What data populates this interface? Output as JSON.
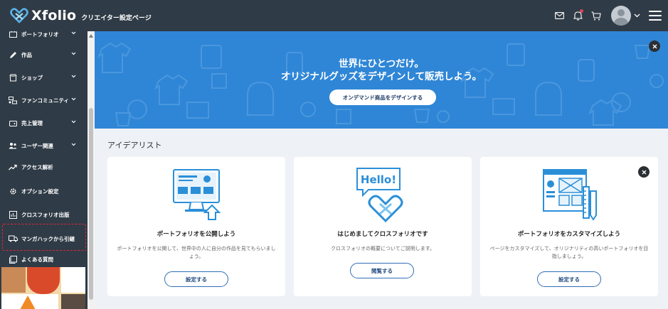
{
  "header": {
    "logo_text": "Xfolio",
    "subtitle": "クリエイター設定ページ"
  },
  "sidebar": {
    "items": [
      {
        "label": "ポートフォリオ"
      },
      {
        "label": "作品"
      },
      {
        "label": "ショップ"
      },
      {
        "label": "ファンコミュニティ"
      },
      {
        "label": "売上管理"
      },
      {
        "label": "ユーザー関連"
      },
      {
        "label": "アクセス解析"
      },
      {
        "label": "オプション設定"
      },
      {
        "label": "クロスフォリオ出版"
      },
      {
        "label": "マンガハックから引継"
      },
      {
        "label": "よくある質問"
      }
    ]
  },
  "hero": {
    "line1": "世界にひとつだけ。",
    "line2": "オリジナルグッズをデザインして販売しよう。",
    "button": "オンデマンド商品をデザインする"
  },
  "ideas": {
    "title": "アイデアリスト",
    "cards": [
      {
        "title": "ポートフォリオを公開しよう",
        "desc": "ポートフォリオを公開して、世界中の人に自分の作品を見てもらいましょう。",
        "button": "設定する",
        "illustration": "monitor-upload-illustration"
      },
      {
        "title": "はじめましてクロスフォリオです",
        "desc": "クロスフォリオの概要についてご説明します。",
        "button": "閲覧する",
        "speech_text": "Hello!",
        "illustration": "hello-heart-illustration"
      },
      {
        "title": "ポートフォリオをカスタマイズしよう",
        "desc": "ページをカスタマイズして、オリジナリティの高いポートフォリオを目指しましょう。",
        "button": "設定する",
        "illustration": "layout-ruler-pencil-illustration"
      }
    ]
  },
  "colors": {
    "header_bg": "#2f3b46",
    "hero_bg": "#2f86d6",
    "accent": "#2e6db4",
    "highlight_dash": "#e0263f"
  }
}
